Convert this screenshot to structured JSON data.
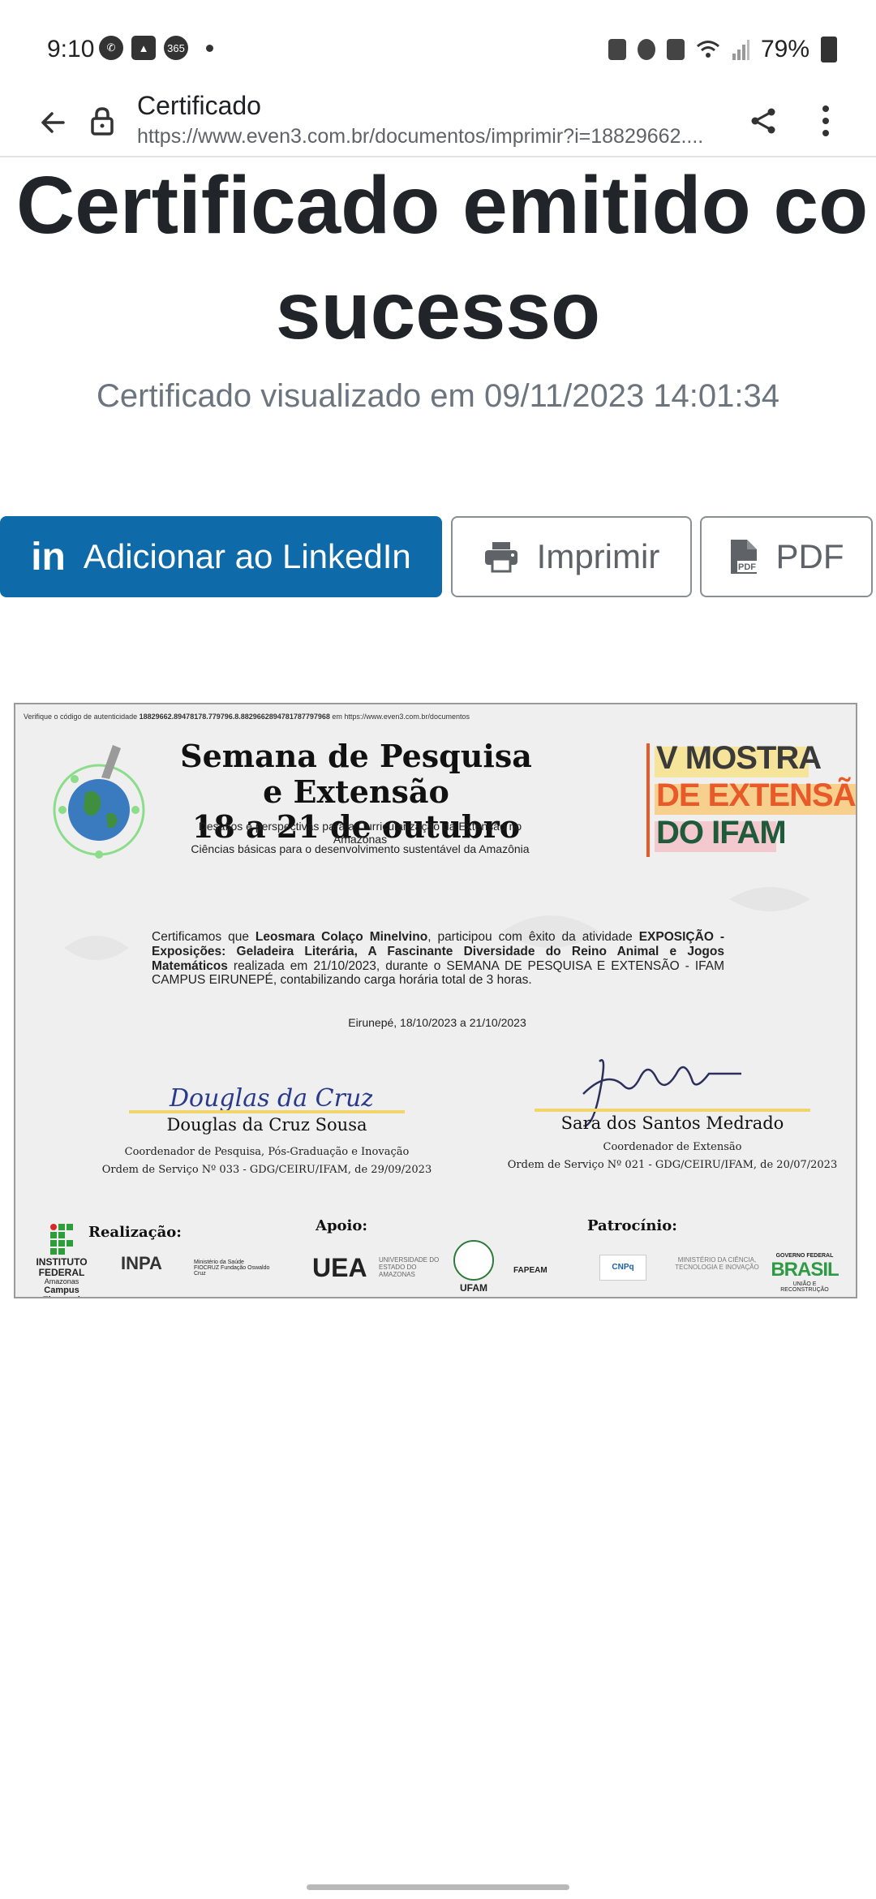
{
  "status_bar": {
    "time": "9:10",
    "battery": "79%",
    "left_icons": [
      "whatsapp-icon",
      "gallery-icon",
      "office-365-icon",
      "dot-icon"
    ],
    "badge_365": "365"
  },
  "browser": {
    "title": "Certificado",
    "url": "https://www.even3.com.br/documentos/imprimir?i=18829662...."
  },
  "page": {
    "heading_line1": "Certificado emitido co",
    "heading_line2": "sucesso",
    "subtitle": "Certificado visualizado em 09/11/2023 14:01:34",
    "buttons": {
      "linkedin_icon_text": "in",
      "linkedin": "Adicionar ao LinkedIn",
      "print": "Imprimir",
      "pdf": "PDF"
    }
  },
  "certificate": {
    "verify_prefix": "Verifique o código de autenticidade",
    "verify_code": "18829662.89478178.779796.8.882966289478178779796​8",
    "verify_suffix": "em https://www.even3.com.br/documentos",
    "event_title_1": "Semana de Pesquisa e Extensão",
    "event_title_2": "18 a 21  de outubro",
    "event_sub_1": "Desafios e perspectivas para a Curricularização da Extensão no Amazonas",
    "event_sub_2": "Ciências básicas para o  desenvolvimento sustentável da Amazônia",
    "mostra_1": "V MOSTRA",
    "mostra_2": "DE EXTENSÃO",
    "mostra_3": "DO IFAM",
    "body_intro": "Certificamos que ",
    "body_name": "Leosmara Colaço Minelvino",
    "body_mid": ", participou com êxito da atividade ",
    "body_activity": "EXPOSIÇÃO - Exposições: Geladeira Literária, A Fascinante Diversidade do Reino Animal e Jogos Matemáticos",
    "body_end": " realizada em 21/10/2023, durante o SEMANA DE PESQUISA E EXTENSÃO - IFAM CAMPUS EIRUNEPÉ, contabilizando carga horária total de 3 horas.",
    "date_line": "Eirunepé, 18/10/2023 a 21/10/2023",
    "signer1": {
      "signature": "Douglas da Cruz Sousa",
      "name": "Douglas da Cruz Sousa",
      "role": "Coordenador de Pesquisa, Pós-Graduação e Inovação",
      "order": "Ordem de Serviço Nº 033 - GDG/CEIRU/IFAM, de 29/09/2023"
    },
    "signer2": {
      "name": "Sara dos Santos Medrado",
      "role": "Coordenador de Extensão",
      "order": "Ordem de Serviço Nº 021 - GDG/CEIRU/IFAM, de 20/07/2023"
    },
    "label_realizacao": "Realização:",
    "label_apoio": "Apoio:",
    "label_patrocinio": "Patrocínio:",
    "logos": {
      "if_1": "INSTITUTO",
      "if_2": "FEDERAL",
      "if_3": "Amazonas",
      "if_4": "Campus Eirunepé",
      "inpa": "INPA",
      "ministerio": "Ministério da Saúde",
      "fiocruz": "FIOCRUZ Fundação Oswaldo Cruz",
      "uea": "UEA",
      "uea_sub": "UNIVERSIDADE DO ESTADO DO AMAZONAS",
      "ufam": "UFAM",
      "fapeam": "FAPEAM",
      "cnpq": "CNPq",
      "mcti": "MINISTÉRIO DA CIÊNCIA, TECNOLOGIA E INOVAÇÃO",
      "gov": "GOVERNO FEDERAL",
      "brasil": "BRASIL",
      "brasil_sub": "UNIÃO E RECONSTRUÇÃO"
    }
  },
  "colors": {
    "linkedin_blue": "#0e6aa8",
    "heading": "#212529",
    "muted": "#6c757d",
    "mostra_orange": "#e95a2a",
    "mostra_green": "#1f5a3a",
    "sig_line": "#f1d46a"
  }
}
